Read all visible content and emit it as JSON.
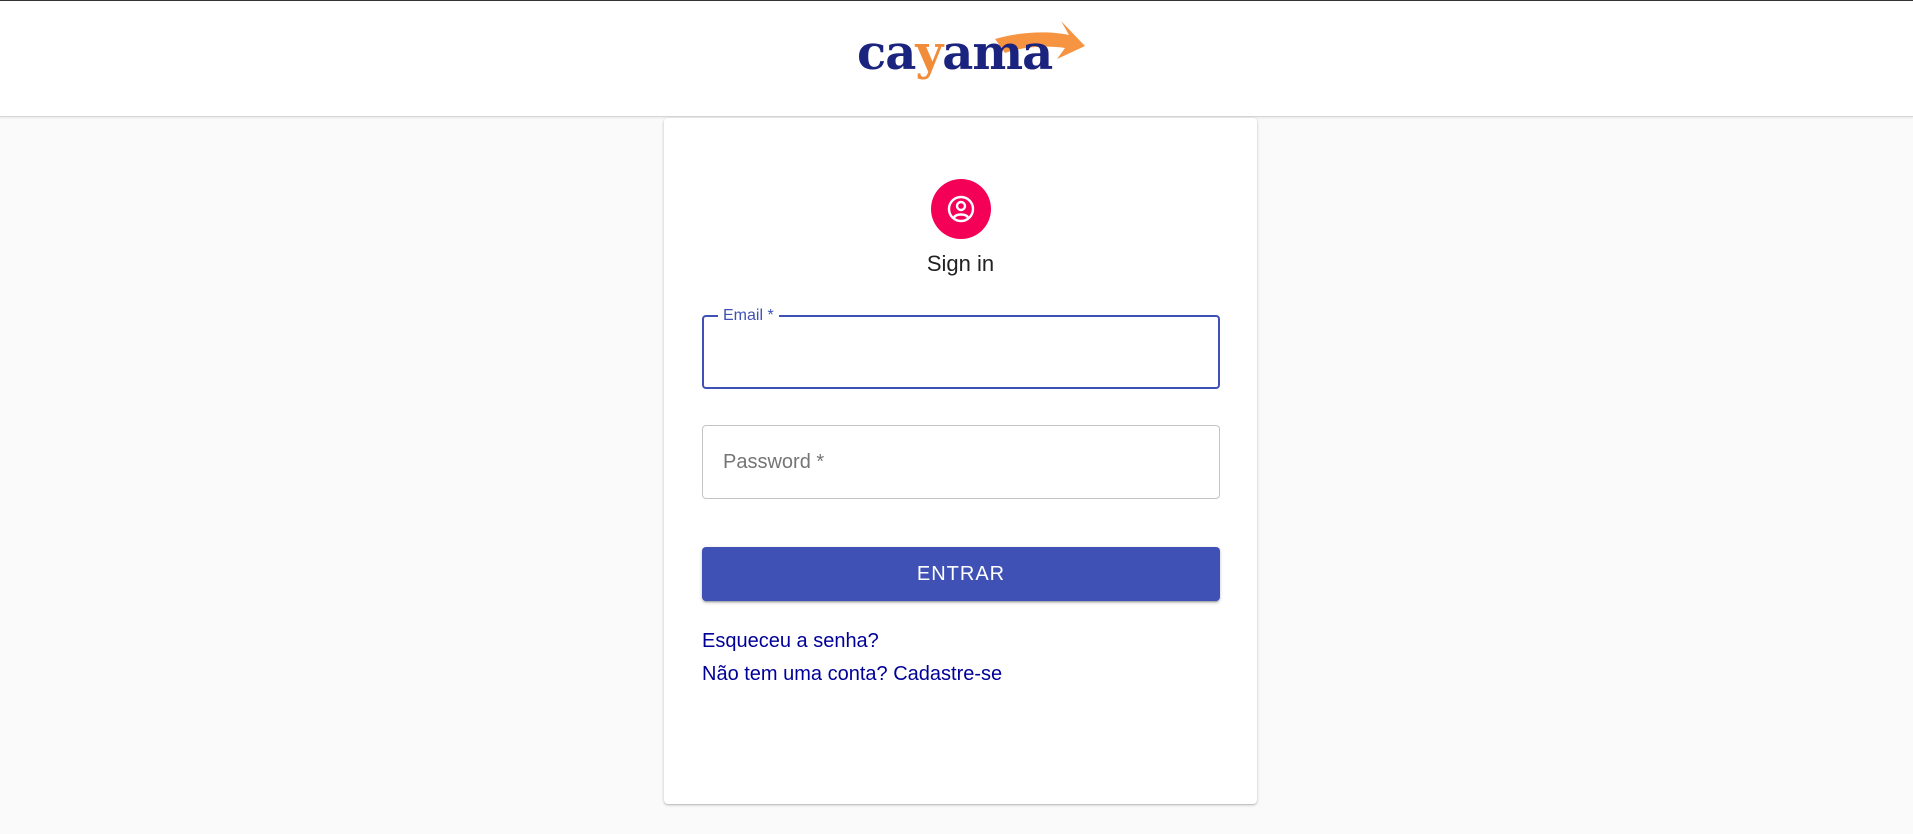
{
  "header": {
    "logo": {
      "text_before": "ca",
      "text_accent": "y",
      "text_after": "ama"
    }
  },
  "signin": {
    "title": "Sign in",
    "avatar_color": "#f50057",
    "email": {
      "label": "Email *",
      "value": ""
    },
    "password": {
      "label": "Password *",
      "value": ""
    },
    "submit_label": "ENTRAR",
    "forgot_link": "Esqueceu a senha?",
    "signup_link": "Não tem uma conta? Cadastre-se"
  },
  "colors": {
    "primary": "#3f51b5",
    "link": "#000099",
    "logo_navy": "#1a237e",
    "logo_orange": "#f08c3a"
  },
  "icons": {
    "avatar": "account-circle-icon"
  }
}
